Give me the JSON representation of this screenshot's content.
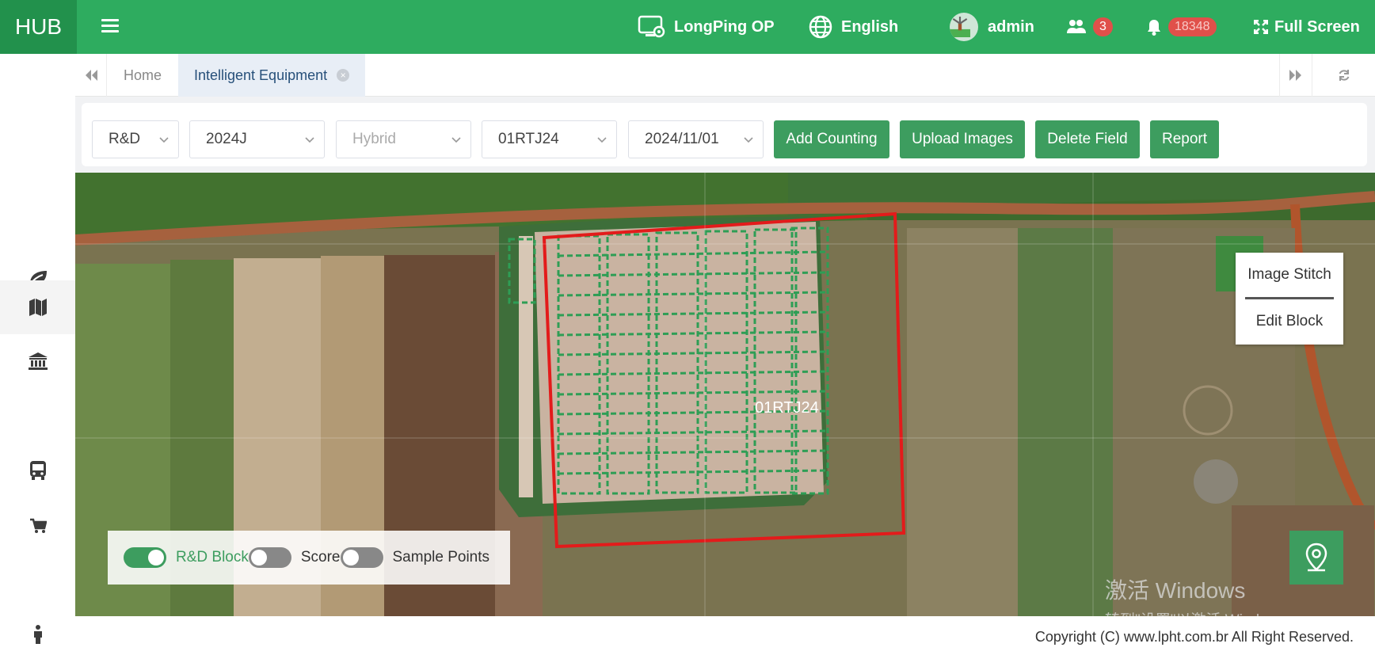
{
  "app": {
    "logo": "HUB"
  },
  "header": {
    "org": "LongPing OP",
    "language": "English",
    "user": "admin",
    "team_count": "3",
    "notification_count": "18348",
    "fullscreen_label": "Full Screen"
  },
  "tabs": {
    "home": "Home",
    "active": "Intelligent Equipment"
  },
  "filters": {
    "program": "R&D",
    "season": "2024J",
    "type_placeholder": "Hybrid",
    "field": "01RTJ24",
    "date": "2024/11/01"
  },
  "actions": {
    "add_counting": "Add Counting",
    "upload_images": "Upload Images",
    "delete_field": "Delete Field",
    "report": "Report"
  },
  "map": {
    "field_label": "01RTJ24",
    "menu": {
      "image_stitch": "Image Stitch",
      "edit_block": "Edit Block"
    },
    "layers": [
      {
        "label": "R&D Block",
        "on": true
      },
      {
        "label": "Score",
        "on": false
      },
      {
        "label": "Sample Points",
        "on": false
      }
    ],
    "watermark_line1": "激活 Windows",
    "watermark_line2": "转到\"设置\"以激活 Windows。"
  },
  "footer": {
    "copyright": "Copyright (C) www.lpht.com.br All Right Reserved."
  },
  "colors": {
    "brand": "#2eac5f",
    "brand_dark": "#22914c",
    "button": "#3d9d5f",
    "badge": "#e0504a",
    "field_outline": "#e31b1b"
  }
}
